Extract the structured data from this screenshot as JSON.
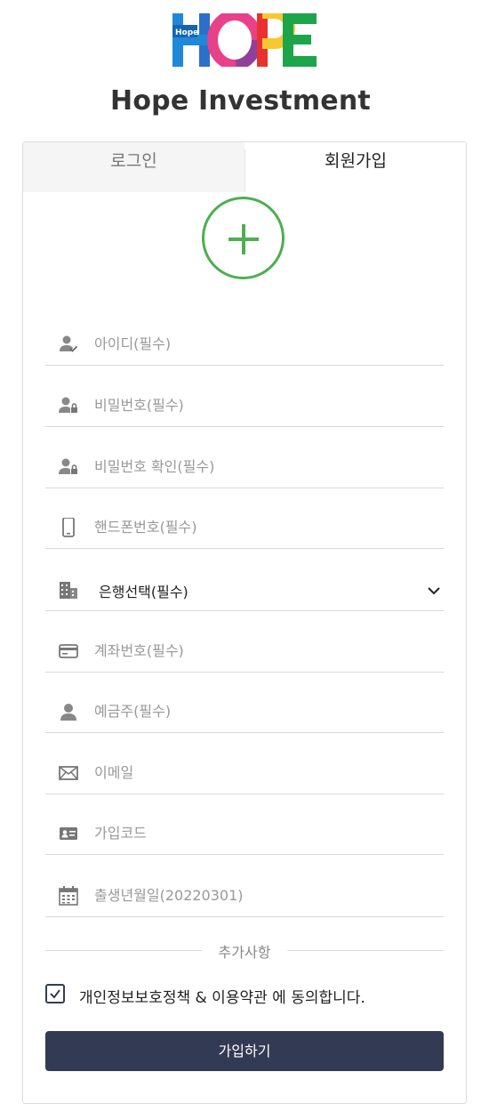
{
  "brand": {
    "logo_word": "HOPE",
    "logo_badge": "Hope",
    "name": "Hope Investment",
    "colors": {
      "blue": "#1f88d8",
      "pink": "#e8418a",
      "yellow": "#f7c830",
      "green": "#1da54a",
      "red": "#e8322f"
    }
  },
  "tabs": [
    {
      "label": "로그인",
      "active": false
    },
    {
      "label": "회원가입",
      "active": true
    }
  ],
  "add_icon": "plus-circle-icon",
  "form": {
    "fields": [
      {
        "icon": "user-check-icon",
        "placeholder": "아이디(필수)",
        "value": ""
      },
      {
        "icon": "user-lock-icon",
        "placeholder": "비밀번호(필수)",
        "value": ""
      },
      {
        "icon": "user-lock-icon",
        "placeholder": "비밀번호 확인(필수)",
        "value": ""
      },
      {
        "icon": "phone-icon",
        "placeholder": "핸드폰번호(필수)",
        "value": ""
      },
      {
        "icon": "bank-building-icon",
        "selected": "은행선택(필수)"
      },
      {
        "icon": "credit-card-icon",
        "placeholder": "계좌번호(필수)",
        "value": ""
      },
      {
        "icon": "user-icon",
        "placeholder": "예금주(필수)",
        "value": ""
      },
      {
        "icon": "envelope-icon",
        "placeholder": "이메일",
        "value": ""
      },
      {
        "icon": "id-card-icon",
        "placeholder": "가입코드",
        "value": ""
      },
      {
        "icon": "calendar-icon",
        "placeholder": "출생년월일(20220301)",
        "value": ""
      }
    ],
    "divider_label": "추가사항",
    "agree_text": "개인정보보호정책 & 이용약관 에 동의합니다.",
    "agree_checked": true,
    "submit_label": "가입하기"
  },
  "accent": "#4caf50",
  "button_color": "#333a53"
}
